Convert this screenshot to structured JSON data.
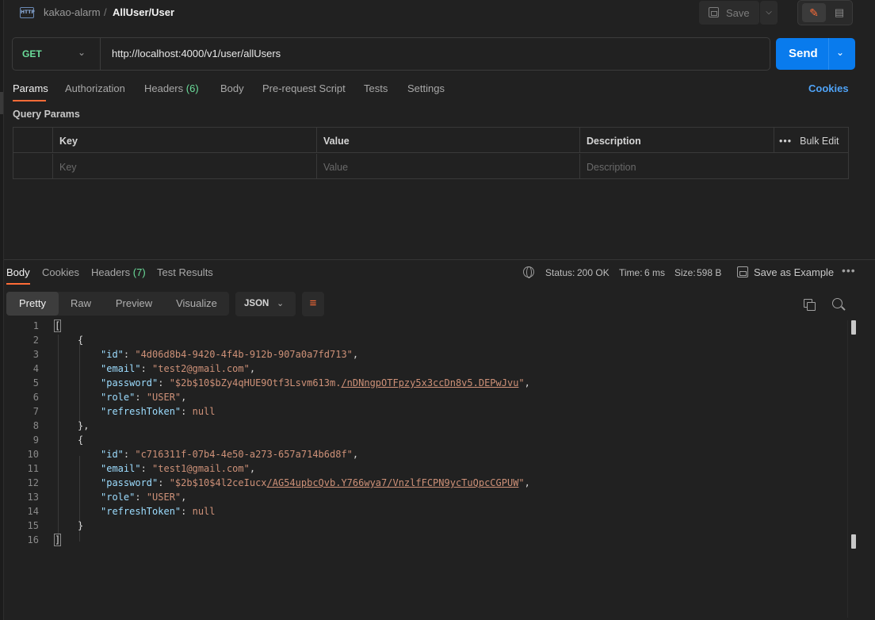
{
  "breadcrumb": {
    "parent": "kakao-alarm",
    "separator": "/",
    "current": "AllUser/User",
    "icon_text": "HTTP"
  },
  "toolbar": {
    "save_label": "Save"
  },
  "request": {
    "method": "GET",
    "url": "http://localhost:4000/v1/user/allUsers",
    "send_label": "Send"
  },
  "request_tabs": {
    "params": "Params",
    "authorization": "Authorization",
    "headers": "Headers",
    "headers_count": "(6)",
    "body": "Body",
    "prerequest": "Pre-request Script",
    "tests": "Tests",
    "settings": "Settings",
    "cookies": "Cookies"
  },
  "query_params": {
    "title": "Query Params",
    "headers": {
      "key": "Key",
      "value": "Value",
      "description": "Description",
      "bulk_edit": "Bulk Edit"
    },
    "placeholders": {
      "key": "Key",
      "value": "Value",
      "description": "Description"
    }
  },
  "response_tabs": {
    "body": "Body",
    "cookies": "Cookies",
    "headers": "Headers",
    "headers_count": "(7)",
    "test_results": "Test Results"
  },
  "response_status": {
    "status_label": "Status:",
    "status_value": "200 OK",
    "time_label": "Time:",
    "time_value": "6 ms",
    "size_label": "Size:",
    "size_value": "598 B",
    "save_example": "Save as Example"
  },
  "view_modes": {
    "pretty": "Pretty",
    "raw": "Raw",
    "preview": "Preview",
    "visualize": "Visualize",
    "format": "JSON"
  },
  "response_body": {
    "line_numbers": [
      "1",
      "2",
      "3",
      "4",
      "5",
      "6",
      "7",
      "8",
      "9",
      "10",
      "11",
      "12",
      "13",
      "14",
      "15",
      "16"
    ],
    "users": [
      {
        "id": "\"4d06d8b4-9420-4f4b-912b-907a0a7fd713\"",
        "email": "\"test2@gmail.com\"",
        "password_head": "\"$2b$10$bZy4qHUE9Otf3Lsvm613m.",
        "password_tail": "/nDNngpOTFpzy5x3ccDn8v5.DEPwJvu",
        "password_end": "\"",
        "role": "\"USER\"",
        "refreshToken": "null"
      },
      {
        "id": "\"c716311f-07b4-4e50-a273-657a714b6d8f\"",
        "email": "\"test1@gmail.com\"",
        "password_head": "\"$2b$10$4l2ceIucx",
        "password_tail": "/AG54upbcQvb.Y766wya7/VnzlfFCPN9ycTuQpcCGPUW",
        "password_end": "\"",
        "role": "\"USER\"",
        "refreshToken": "null"
      }
    ],
    "keys": {
      "id": "\"id\"",
      "email": "\"email\"",
      "password": "\"password\"",
      "role": "\"role\"",
      "refreshToken": "\"refreshToken\""
    },
    "punct": {
      "open_array": "[",
      "close_array": "]",
      "open_obj": "{",
      "close_obj": "}",
      "close_obj_comma": "},",
      "colon": ": ",
      "comma": ","
    }
  },
  "colors": {
    "accent": "#ff6c37",
    "send": "#097bed",
    "status_ok": "#6bdd9a",
    "json_key": "#9cdcfe",
    "json_string": "#ce9178"
  }
}
